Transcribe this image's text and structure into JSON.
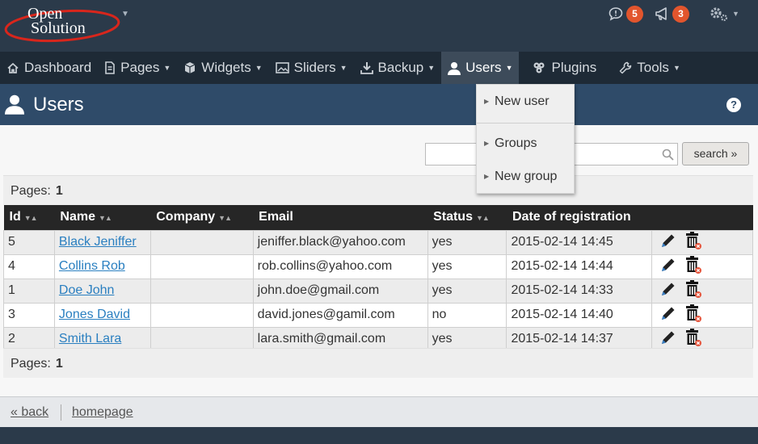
{
  "brand": {
    "logo_line1": "Open",
    "logo_line2": "Solution"
  },
  "topbar": {
    "notifications_count": "5",
    "messages_count": "3"
  },
  "menu": [
    {
      "label": "Dashboard",
      "icon": "home-icon"
    },
    {
      "label": "Pages",
      "icon": "page-icon"
    },
    {
      "label": "Widgets",
      "icon": "cube-icon"
    },
    {
      "label": "Sliders",
      "icon": "image-icon"
    },
    {
      "label": "Backup",
      "icon": "download-icon"
    },
    {
      "label": "Users",
      "icon": "user-icon"
    },
    {
      "label": "Plugins",
      "icon": "plugin-icon"
    },
    {
      "label": "Tools",
      "icon": "wrench-icon"
    }
  ],
  "dropdown": {
    "new_user": "New user",
    "groups": "Groups",
    "new_group": "New group"
  },
  "page": {
    "title": "Users",
    "help": "?"
  },
  "search": {
    "placeholder": "",
    "button": "search »"
  },
  "pagination": {
    "label": "Pages:",
    "current": "1"
  },
  "table": {
    "columns": [
      "Id",
      "Name",
      "Company",
      "Email",
      "Status",
      "Date of registration"
    ],
    "rows": [
      {
        "id": "5",
        "name": "Black Jeniffer",
        "company": "",
        "email": "jeniffer.black@yahoo.com",
        "status": "yes",
        "date": "2015-02-14 14:45"
      },
      {
        "id": "4",
        "name": "Collins Rob",
        "company": "",
        "email": "rob.collins@yahoo.com",
        "status": "yes",
        "date": "2015-02-14 14:44"
      },
      {
        "id": "1",
        "name": "Doe John",
        "company": "",
        "email": "john.doe@gmail.com",
        "status": "yes",
        "date": "2015-02-14 14:33"
      },
      {
        "id": "3",
        "name": "Jones David",
        "company": "",
        "email": "david.jones@gamil.com",
        "status": "no",
        "date": "2015-02-14 14:40"
      },
      {
        "id": "2",
        "name": "Smith Lara",
        "company": "",
        "email": "lara.smith@gmail.com",
        "status": "yes",
        "date": "2015-02-14 14:37"
      }
    ]
  },
  "footer": {
    "back": "« back",
    "homepage": "homepage"
  },
  "colors": {
    "topbar": "#2b3a4a",
    "menubar": "#1e2a36",
    "titlebar": "#2f4b69",
    "badge": "#e2552d",
    "link": "#2a7fc0"
  }
}
